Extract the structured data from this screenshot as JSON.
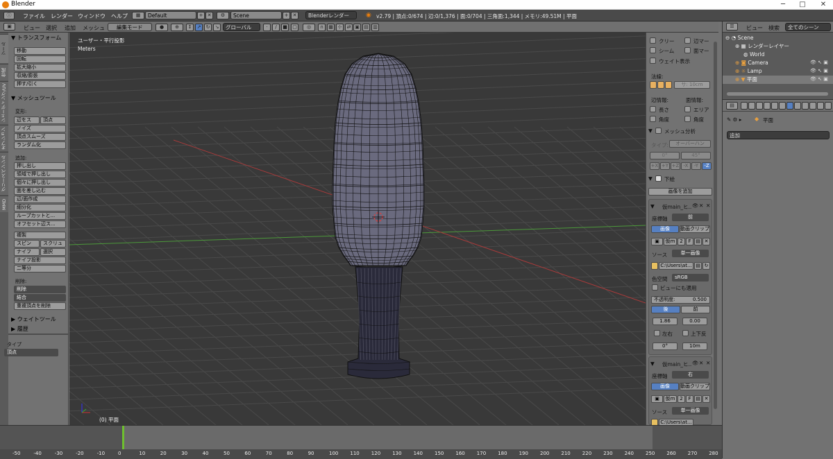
{
  "window": {
    "title": "Blender",
    "minimize": "─",
    "maximize": "□",
    "close": "✕"
  },
  "infobar": {
    "menus": [
      "ファイル",
      "レンダー",
      "ウィンドウ",
      "ヘルプ"
    ],
    "layout": "Default",
    "scene": "Scene",
    "engine": "Blenderレンダー",
    "stats": "v2.79 | 頂点:0/674 | 辺:0/1,376 | 面:0/704 | 三角面:1,344 | メモリ:49.51M | 平面"
  },
  "view_toolbar": {
    "menus": [
      "ビュー",
      "選択",
      "追加",
      "メッシュ"
    ],
    "mode": "編集モード",
    "orientation": "グローバル"
  },
  "left_tabs": [
    "ツール",
    "作成",
    "シェーディング/UV",
    "オプション",
    "グリースペンシル",
    "MMD"
  ],
  "toolshelf": {
    "transform_header": "▼ トランスフォーム",
    "transform": [
      "移動",
      "回転",
      "拡大縮小",
      "収縮/膨張",
      "押す/引く"
    ],
    "meshtools_header": "▼ メッシュツール",
    "deform_label": "変形:",
    "deform_pair": [
      "辺をス",
      "頂点"
    ],
    "deform": [
      "ノイズ",
      "頂点スムーズ",
      "ランダム化"
    ],
    "add_label": "追加:",
    "extrude": "押し出し",
    "add": [
      "領域で押し出し",
      "個々に押し出し",
      "面を差し込む",
      "辺/面作成",
      "細分化",
      "ループカットと...",
      "オフセット辺ス..."
    ],
    "duplicate": "複製",
    "pair1": [
      "スピン",
      "スクリュ"
    ],
    "pair2": [
      "ナイフ",
      "選択"
    ],
    "knife_project": "ナイフ投影",
    "bisect": "二等分",
    "delete_label": "削除:",
    "delete": "削除",
    "merge": "結合",
    "remove_doubles": "重複頂点を削除",
    "weight_tools": "▶ ウェイトツール",
    "history": "▶ 履歴",
    "type_label": "タイプ",
    "type_value": "頂点"
  },
  "viewport": {
    "view_label": "ユーザー・平行投影",
    "units": "Meters",
    "object_label": "(0) 平面"
  },
  "npanel": {
    "top_checks": [
      [
        "クリー",
        "辺マー"
      ],
      [
        "シーム",
        "面マー"
      ]
    ],
    "weight_display": "ウェイト表示",
    "normals_label": "法線:",
    "normal_size": "サ: 10cm",
    "edge_info": "辺情報:",
    "face_info": "面情報:",
    "info_checks": [
      [
        "長さ",
        "エリア"
      ],
      [
        "角度",
        "角度"
      ]
    ],
    "mesh_analysis": "メッシュ分析",
    "type_label": "タイプ:",
    "type_value": "オーバーハン",
    "angle_min": "0°",
    "angle_max": "45°",
    "axes": [
      "+X",
      "+Y",
      "+Z",
      "-X",
      "-Y",
      "-Z"
    ],
    "background": "下絵",
    "add_image": "画像を追加",
    "bg1": {
      "name": "仮main_ヒ...",
      "axis_label": "座標軸",
      "axis": "前",
      "image": "画像",
      "movie": "動画クリップ",
      "img_name": "仮m",
      "users": "2",
      "fake": "F",
      "source_label": "ソース",
      "source": "単一画像",
      "path": "C:\\Users\\at...",
      "colorspace_label": "色空間",
      "colorspace": "sRGB",
      "view_as_render": "ビューにも適用",
      "opacity_label": "不透明度:",
      "opacity": "0.500",
      "back": "後",
      "front": "前",
      "x": "1.86",
      "y": "0.00",
      "flip_x": "左右",
      "flip_y": "上下反",
      "rotation": "0°",
      "size": "10m"
    },
    "bg2": {
      "name": "仮main_ヒ...",
      "axis_label": "座標軸",
      "axis": "右",
      "image": "画像",
      "movie": "動画クリップ",
      "img_name": "仮m",
      "users": "2",
      "fake": "F",
      "source_label": "ソース",
      "source": "単一画像",
      "path": "C:\\Users\\at..."
    }
  },
  "outliner": {
    "menus": [
      "ビュー",
      "検索"
    ],
    "filter": "全てのシーン",
    "items": [
      "Scene",
      "レンダーレイヤー",
      "World",
      "Camera",
      "Lamp",
      "平面"
    ]
  },
  "properties": {
    "object": "平面",
    "modifier_add": "追加"
  },
  "timeline": {
    "ticks": [
      "-50",
      "-40",
      "-30",
      "-20",
      "-10",
      "0",
      "10",
      "20",
      "30",
      "40",
      "50",
      "60",
      "70",
      "80",
      "90",
      "100",
      "110",
      "120",
      "130",
      "140",
      "150",
      "160",
      "170",
      "180",
      "190",
      "200",
      "210",
      "220",
      "230",
      "240",
      "250",
      "260",
      "270",
      "280"
    ],
    "current_frame": 0
  },
  "colors": {
    "accent": "#5680c2",
    "frame_marker": "#6ec02e",
    "axis_x": "#a83a3a",
    "axis_y": "#4c9a3a"
  }
}
